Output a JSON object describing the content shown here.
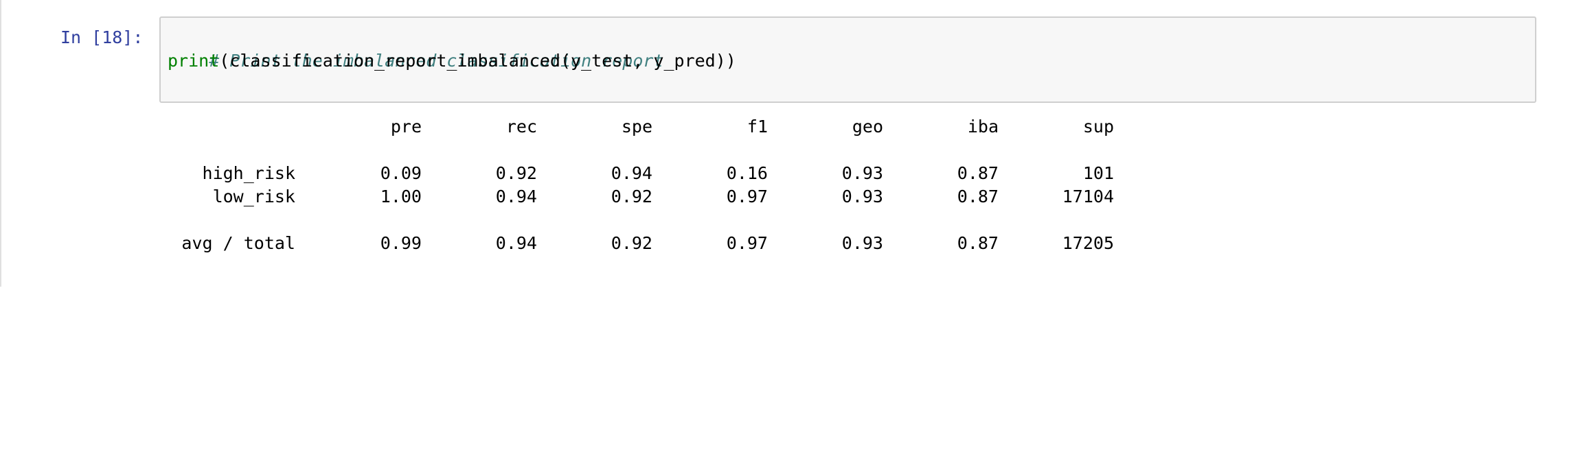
{
  "cell": {
    "prompt": "In [18]:",
    "code": {
      "comment": "# Print the imbalanced classification report",
      "builtin": "print",
      "rest": "(classification_report_imbalanced(y_test, y_pred))"
    }
  },
  "output": {
    "headers": [
      "pre",
      "rec",
      "spe",
      "f1",
      "geo",
      "iba",
      "sup"
    ],
    "rows": [
      {
        "label": "high_risk",
        "values": [
          "0.09",
          "0.92",
          "0.94",
          "0.16",
          "0.93",
          "0.87",
          "101"
        ]
      },
      {
        "label": "low_risk",
        "values": [
          "1.00",
          "0.94",
          "0.92",
          "0.97",
          "0.93",
          "0.87",
          "17104"
        ]
      }
    ],
    "total": {
      "label": "avg / total",
      "values": [
        "0.99",
        "0.94",
        "0.92",
        "0.97",
        "0.93",
        "0.87",
        "17205"
      ]
    }
  }
}
